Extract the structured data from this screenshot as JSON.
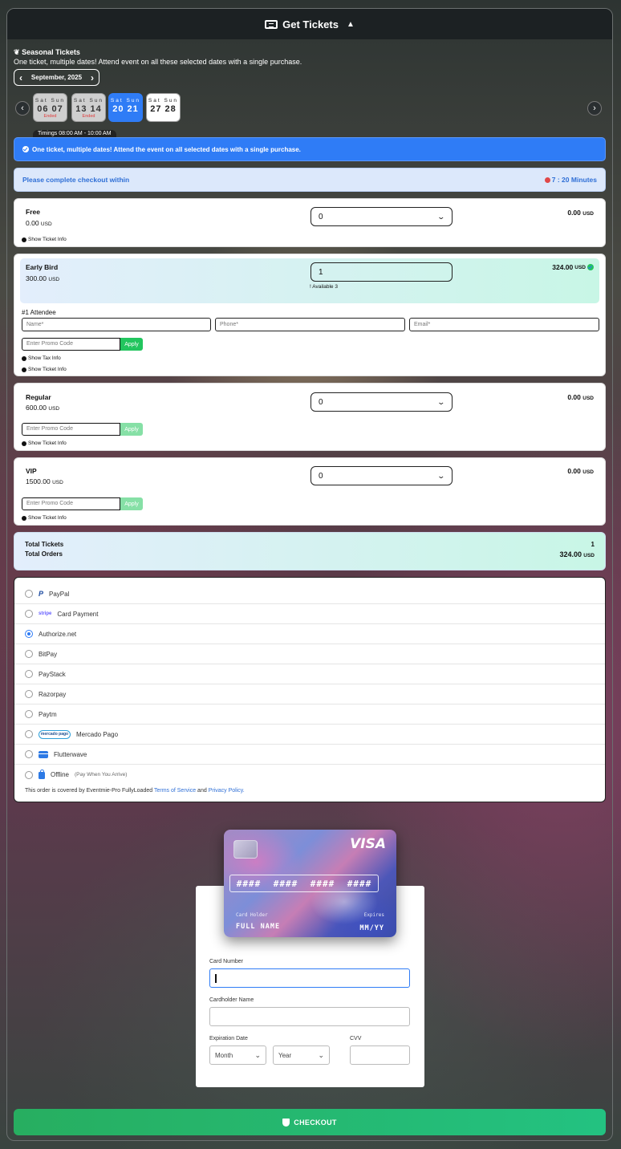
{
  "header": {
    "title": "Get Tickets",
    "toggle_icon": "▲"
  },
  "seasonal": {
    "title": "Seasonal Tickets",
    "subtitle": "One ticket, multiple dates! Attend event on all these selected dates with a single purchase.",
    "month": "September, 2025",
    "dates": [
      {
        "days": "Sat Sun",
        "nums": "06 07",
        "status": "Ended"
      },
      {
        "days": "Sat Sun",
        "nums": "13 14",
        "status": "Ended"
      },
      {
        "days": "Sat Sun",
        "nums": "20 21",
        "status": ""
      },
      {
        "days": "Sat Sun",
        "nums": "27 28",
        "status": ""
      }
    ],
    "timings": "Timings  08:00 AM - 10:00 AM"
  },
  "notice": "One ticket, multiple dates! Attend the event on all selected dates with a single purchase.",
  "checkout_timer": {
    "label": "Please complete checkout within",
    "value": "7 : 20 Minutes"
  },
  "tickets": {
    "free": {
      "name": "Free",
      "price": "0.00",
      "currency": "USD",
      "qty": "0",
      "total": "0.00",
      "show_info": "Show Ticket Info"
    },
    "early": {
      "name": "Early Bird",
      "price": "300.00",
      "currency": "USD",
      "qty": "1",
      "available": "Available 3",
      "total": "324.00",
      "attendee_title": "#1 Attendee",
      "name_ph": "Name*",
      "phone_ph": "Phone*",
      "email_ph": "Email*",
      "promo_ph": "Enter Promo Code",
      "apply": "Apply",
      "show_tax": "Show Tax Info",
      "show_info": "Show Ticket Info"
    },
    "regular": {
      "name": "Regular",
      "price": "600.00",
      "currency": "USD",
      "qty": "0",
      "total": "0.00",
      "promo_ph": "Enter Promo Code",
      "apply": "Apply",
      "show_info": "Show Ticket Info"
    },
    "vip": {
      "name": "VIP",
      "price": "1500.00",
      "currency": "USD",
      "qty": "0",
      "total": "0.00",
      "promo_ph": "Enter Promo Code",
      "apply": "Apply",
      "show_info": "Show Ticket Info"
    }
  },
  "summary": {
    "tickets_label": "Total Tickets",
    "tickets_value": "1",
    "orders_label": "Total Orders",
    "orders_value": "324.00",
    "currency": "USD"
  },
  "payment": {
    "methods": [
      "PayPal",
      "Card Payment",
      "Authorize.net",
      "BitPay",
      "PayStack",
      "Razorpay",
      "Paytm",
      "Mercado Pago",
      "Flutterwave",
      "Offline"
    ],
    "selected": "Authorize.net",
    "offline_note": "(Pay When You Arrive)",
    "stripe_logo": "stripe",
    "mp_logo": "mercado pago",
    "terms_prefix": "This order is covered by Eventmie-Pro FullyLoaded",
    "terms_link": "Terms of Service",
    "terms_and": "and",
    "privacy_link": "Privacy Policy."
  },
  "card_preview": {
    "brand": "VISA",
    "number": [
      "####",
      "####",
      "####",
      "####"
    ],
    "holder_label": "Card Holder",
    "holder_value": "FULL NAME",
    "expires_label": "Expires",
    "expires_value": "MM/YY"
  },
  "card_form": {
    "number_label": "Card Number",
    "holder_label": "Cardholder Name",
    "exp_label": "Expiration Date",
    "month": "Month",
    "year": "Year",
    "cvv_label": "CVV"
  },
  "checkout_button": "CHECKOUT",
  "colors": {
    "primary_blue": "#2f7cf6",
    "green": "#22c55e",
    "ended_red": "#e03a3a"
  }
}
